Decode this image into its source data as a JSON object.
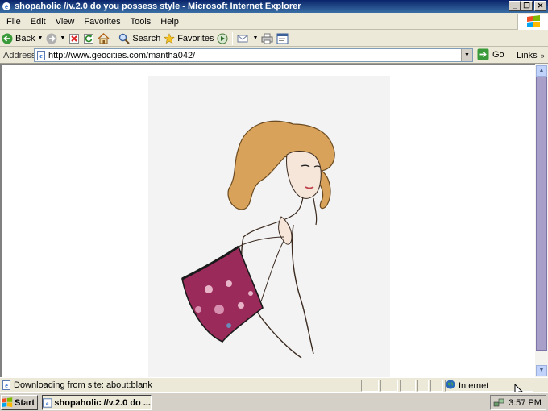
{
  "window": {
    "title": "shopaholic //v.2.0 do you possess style - Microsoft Internet Explorer"
  },
  "menu": [
    "File",
    "Edit",
    "View",
    "Favorites",
    "Tools",
    "Help"
  ],
  "toolbar": {
    "back_label": "Back",
    "search_label": "Search",
    "favorites_label": "Favorites"
  },
  "address": {
    "label": "Address",
    "url": "http://www.geocities.com/mantha042/",
    "go_label": "Go",
    "links_label": "Links"
  },
  "page": {
    "image_icon": "fashion-illustration-woman-with-handbag"
  },
  "status": {
    "text": "Downloading from site: about:blank",
    "zone": "Internet"
  },
  "taskbar": {
    "start_label": "Start",
    "task_label": "shopaholic //v.2.0 do ...",
    "clock": "3:57 PM"
  }
}
